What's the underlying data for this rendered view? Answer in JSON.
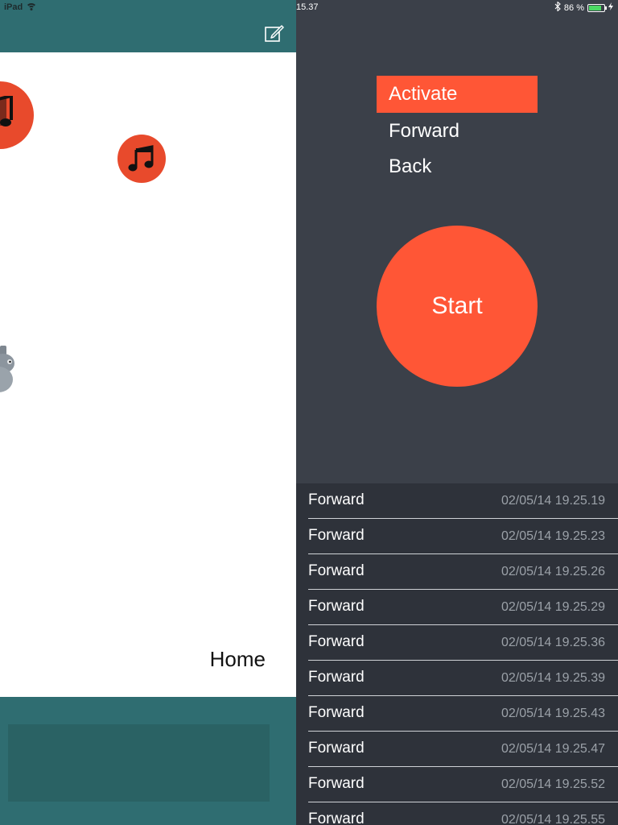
{
  "status": {
    "device": "iPad",
    "time": "15.37",
    "battery_text": "86 %",
    "battery_level": 0.86
  },
  "colors": {
    "accent": "#ff5636",
    "teal": "#2f6d71",
    "panel_dark": "#3b4049",
    "list_dark": "#2e323a"
  },
  "left": {
    "compose_icon": "compose-icon",
    "note_icon": "music-note-icon",
    "home_label": "Home"
  },
  "menu": {
    "items": [
      {
        "label": "Activate",
        "active": true
      },
      {
        "label": "Forward",
        "active": false
      },
      {
        "label": "Back",
        "active": false
      }
    ]
  },
  "start_label": "Start",
  "log": [
    {
      "action": "Forward",
      "time": "02/05/14 19.25.19"
    },
    {
      "action": "Forward",
      "time": "02/05/14 19.25.23"
    },
    {
      "action": "Forward",
      "time": "02/05/14 19.25.26"
    },
    {
      "action": "Forward",
      "time": "02/05/14 19.25.29"
    },
    {
      "action": "Forward",
      "time": "02/05/14 19.25.36"
    },
    {
      "action": "Forward",
      "time": "02/05/14 19.25.39"
    },
    {
      "action": "Forward",
      "time": "02/05/14 19.25.43"
    },
    {
      "action": "Forward",
      "time": "02/05/14 19.25.47"
    },
    {
      "action": "Forward",
      "time": "02/05/14 19.25.52"
    },
    {
      "action": "Forward",
      "time": "02/05/14 19.25.55"
    }
  ]
}
